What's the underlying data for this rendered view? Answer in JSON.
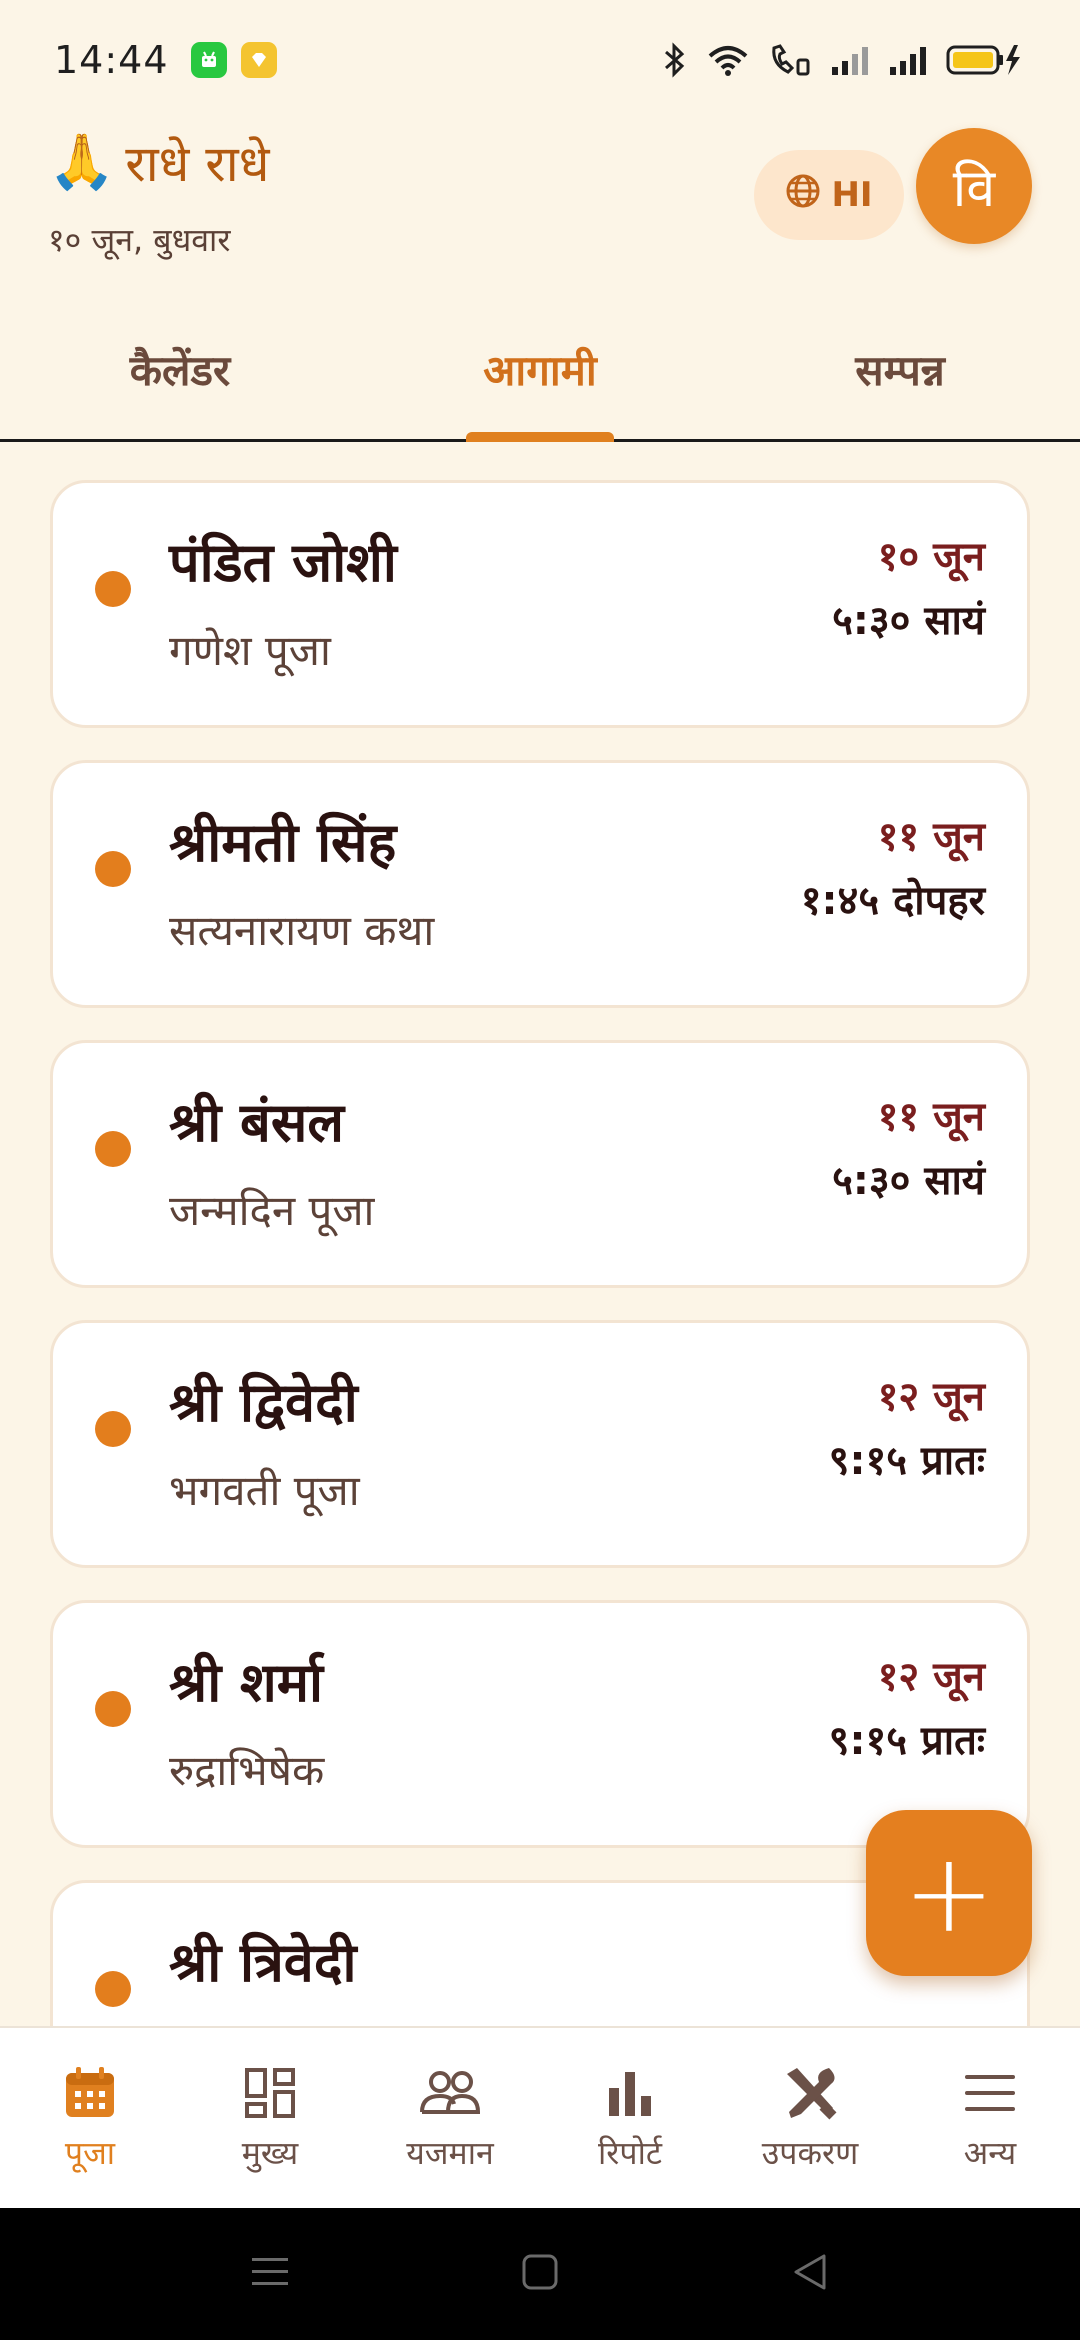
{
  "status_bar": {
    "time": "14:44"
  },
  "header": {
    "greeting_emoji": "🙏",
    "greeting": "राधे राधे",
    "date": "१० जून, बुधवार",
    "language_code": "HI",
    "avatar_initial": "वि"
  },
  "tabs": [
    {
      "label": "कैलेंडर"
    },
    {
      "label": "आगामी"
    },
    {
      "label": "सम्पन्न"
    }
  ],
  "bookings": [
    {
      "name": "पंडित जोशी",
      "puja": "गणेश पूजा",
      "date": "१० जून",
      "time": "५:३० सायं"
    },
    {
      "name": "श्रीमती सिंह",
      "puja": "सत्यनारायण कथा",
      "date": "११ जून",
      "time": "१:४५ दोपहर"
    },
    {
      "name": "श्री बंसल",
      "puja": "जन्मदिन पूजा",
      "date": "११ जून",
      "time": "५:३० सायं"
    },
    {
      "name": "श्री द्विवेदी",
      "puja": "भगवती पूजा",
      "date": "१२ जून",
      "time": "९:१५ प्रातः"
    },
    {
      "name": "श्री शर्मा",
      "puja": "रुद्राभिषेक",
      "date": "१२ जून",
      "time": "९:१५ प्रातः"
    },
    {
      "name": "श्री त्रिवेदी",
      "puja": "",
      "date": "",
      "time": ""
    }
  ],
  "fab": {
    "label": "+"
  },
  "bottom_nav": [
    {
      "label": "पूजा",
      "icon": "calendar-icon"
    },
    {
      "label": "मुख्य",
      "icon": "dashboard-icon"
    },
    {
      "label": "यजमान",
      "icon": "people-icon"
    },
    {
      "label": "रिपोर्ट",
      "icon": "bar-chart-icon"
    },
    {
      "label": "उपकरण",
      "icon": "tools-icon"
    },
    {
      "label": "अन्य",
      "icon": "menu-icon"
    }
  ],
  "colors": {
    "background": "#fcf5e7",
    "accent": "#e0801f",
    "date_text": "#7a1e1e",
    "card_background": "#ffffff"
  }
}
